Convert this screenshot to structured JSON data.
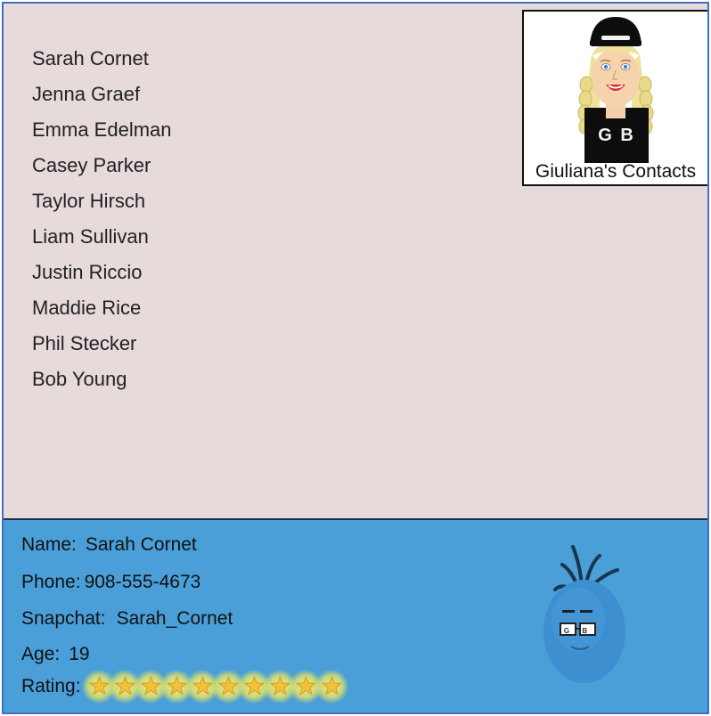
{
  "contacts": [
    "Sarah Cornet",
    "Jenna Graef",
    "Emma Edelman",
    "Casey Parker",
    "Taylor Hirsch",
    "Liam Sullivan",
    "Justin Riccio",
    "Maddie Rice",
    "Phil Stecker",
    "Bob Young"
  ],
  "badge": {
    "title": "Giuliana's Contacts",
    "shirt_text": "G B",
    "icon": "avatar-girl-icon"
  },
  "details": {
    "name_label": "Name:",
    "name_value": "Sarah Cornet",
    "phone_label": "Phone:",
    "phone_value": "908-555-4673",
    "snapchat_label": "Snapchat:",
    "snapchat_value": "Sarah_Cornet",
    "age_label": "Age:",
    "age_value": "19",
    "rating_label": "Rating:",
    "rating_value": 10,
    "rating_max": 10,
    "mascot_glasses_text": "G B",
    "mascot_icon": "blue-egg-mascot-icon"
  },
  "colors": {
    "list_background": "#e6dadb",
    "details_background": "#4b9fd8",
    "frame_border": "#3f6fc9",
    "star": "#f2c23a",
    "star_glow": "#f2ee7a"
  }
}
